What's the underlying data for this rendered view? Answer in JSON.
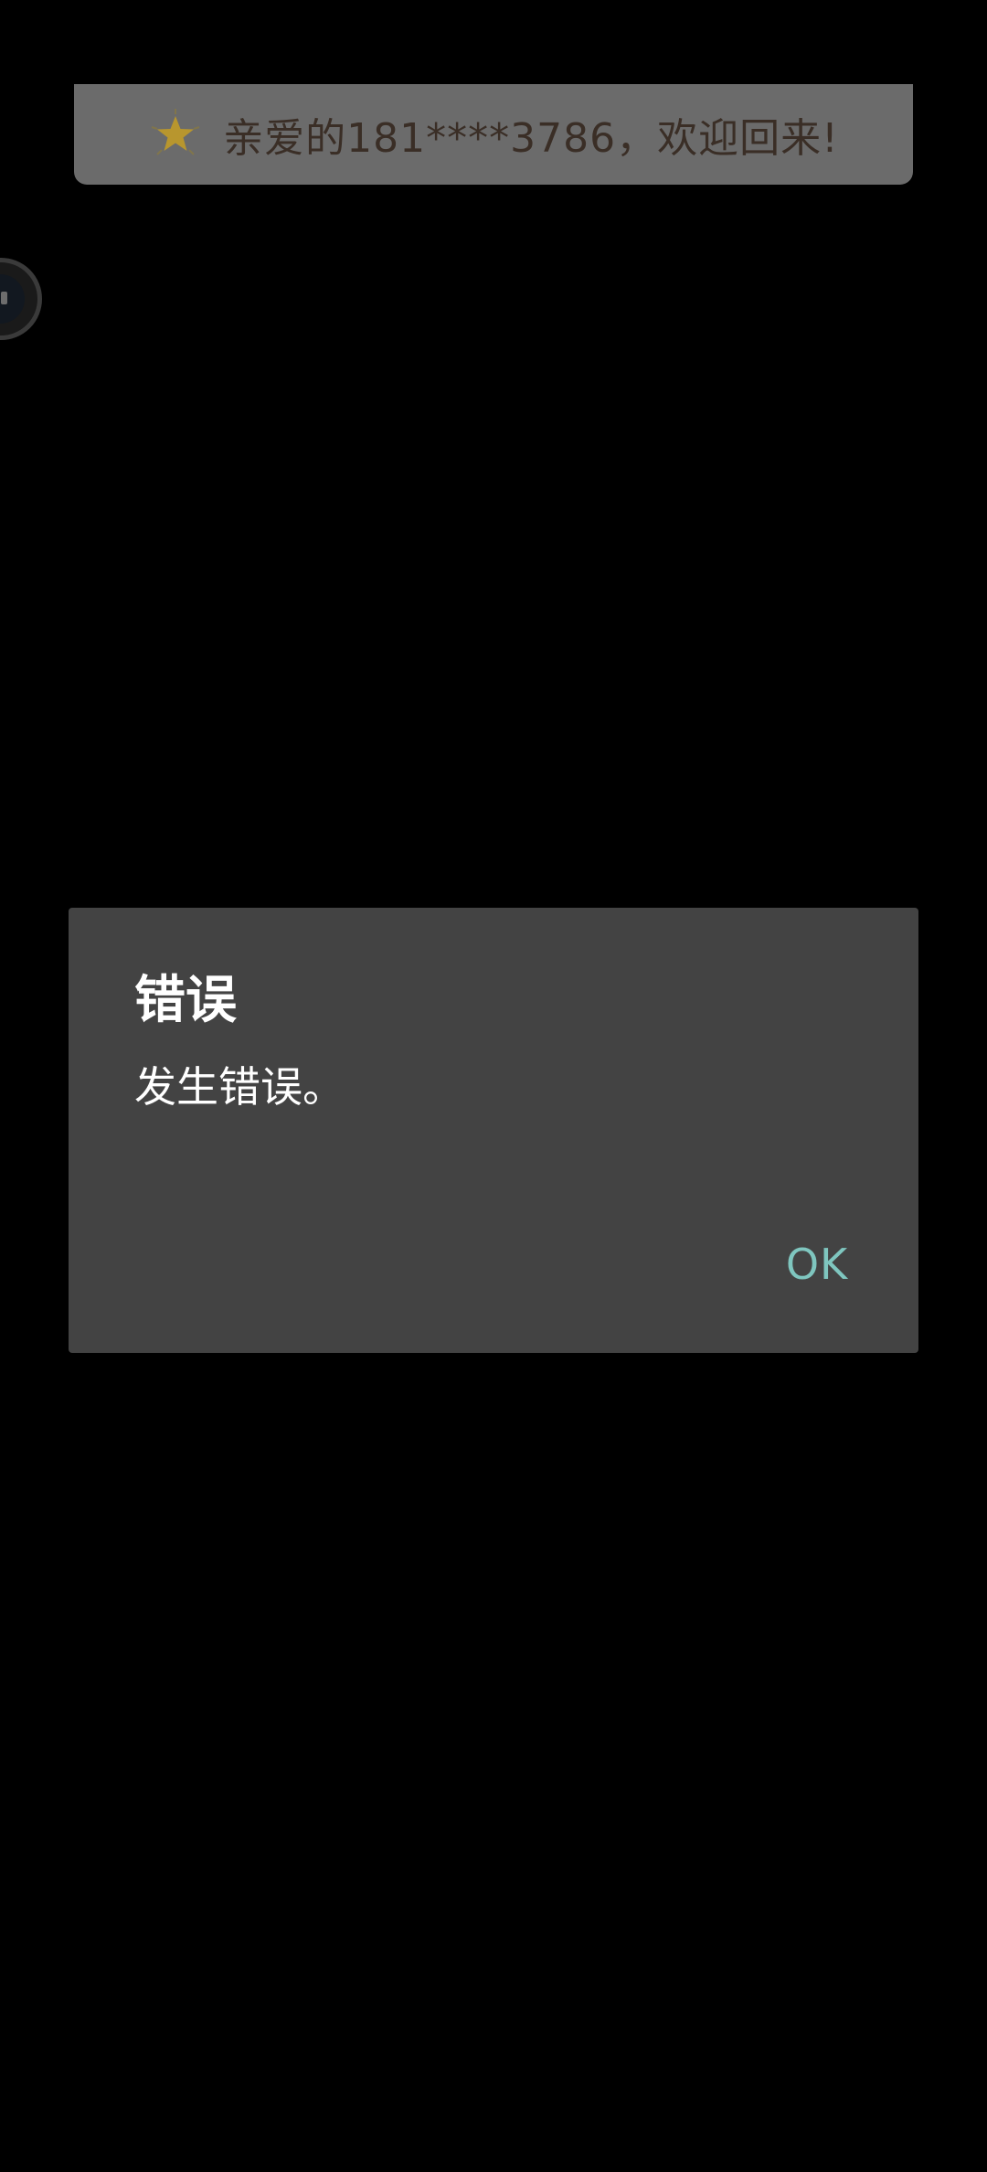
{
  "welcome_toast": {
    "icon": "star-icon",
    "message": "亲爱的181****3786，欢迎回来!",
    "star_color": "#b8962e"
  },
  "floating_button": {
    "icon": "chat-bubble-icon"
  },
  "dialog": {
    "title": "错误",
    "message": "发生错误。",
    "ok_label": "OK",
    "accent_color": "#7fc6bf"
  }
}
